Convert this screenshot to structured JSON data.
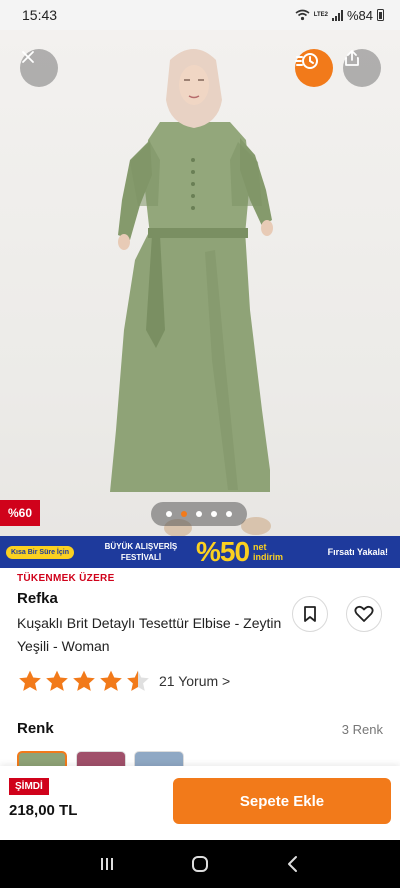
{
  "status_bar": {
    "time": "15:43",
    "network": "LTE2",
    "battery": "%84"
  },
  "product": {
    "discount_badge": "%60",
    "image_count": 5,
    "active_image": 2,
    "stock_label": "TÜKENMEK ÜZERE",
    "brand": "Refka",
    "title": "Kuşaklı Brit Detaylı Tesettür Elbise - Zeytin Yeşili -  Woman",
    "rating": 4.5,
    "review_link": "21 Yorum >",
    "image_colors": {
      "dress": "#8fa377",
      "dress_shadow": "#7a8f62",
      "hijab": "#e8d2c4"
    }
  },
  "banner": {
    "tag": "Kısa Bir Süre İçin",
    "festival": "BÜYÜK ALIŞVERİŞ FESTİVALİ",
    "percent": "%50",
    "net": "net",
    "indirim": "indirim",
    "link": "Fırsatı Yakala!",
    "colors": {
      "background": "#1e3a9c",
      "accent": "#fbd020"
    }
  },
  "colors_section": {
    "title": "Renk",
    "count": "3 Renk",
    "swatches": [
      "#8fa377",
      "#a0506a",
      "#8fa8c4"
    ]
  },
  "bottom_bar": {
    "now_label": "ŞİMDİ",
    "price": "218,00 TL",
    "cart_button": "Sepete Ekle"
  },
  "theme": {
    "accent": "#f27a1a",
    "discount_red": "#d0021b"
  },
  "icons": {
    "close": "close-icon",
    "recent": "recently-viewed-icon",
    "share": "share-icon",
    "collection": "bookmark-icon",
    "favorite": "heart-icon",
    "nav_recents": "recents-icon",
    "nav_home": "home-icon",
    "nav_back": "back-icon"
  }
}
